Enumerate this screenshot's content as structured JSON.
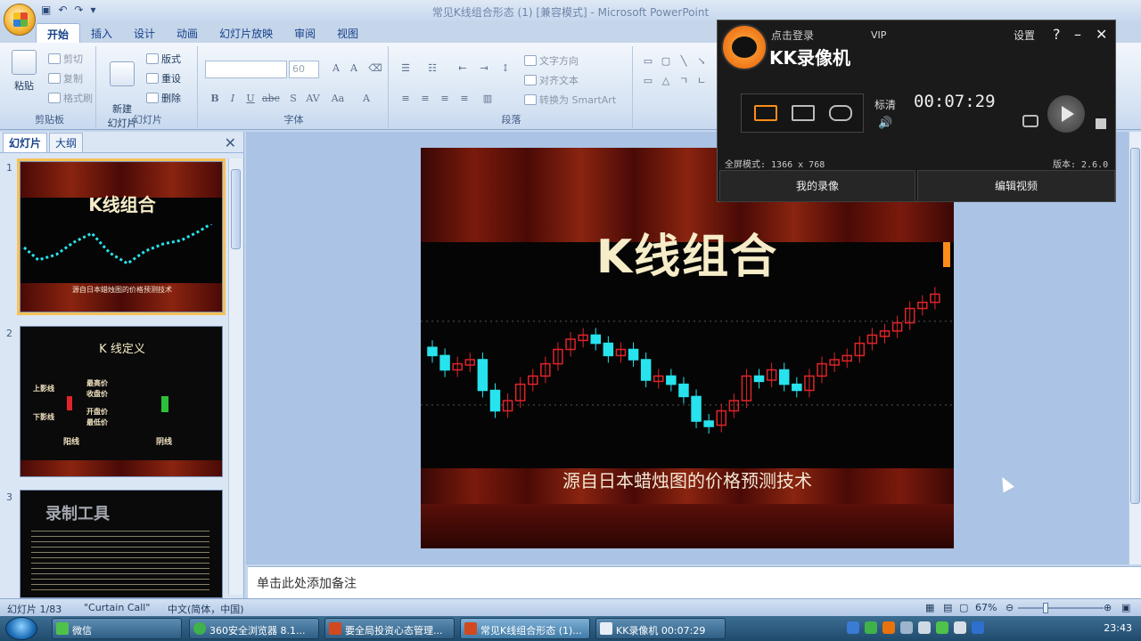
{
  "window": {
    "title": "常见K线组合形态 (1) [兼容模式] - Microsoft PowerPoint"
  },
  "ribbon": {
    "tabs": [
      "开始",
      "插入",
      "设计",
      "动画",
      "幻灯片放映",
      "审阅",
      "视图"
    ],
    "clipboard": {
      "paste": "粘贴",
      "cut": "剪切",
      "copy": "复制",
      "format_painter": "格式刷",
      "label": "剪贴板"
    },
    "slides": {
      "new_slide": "新建\n幻灯片",
      "layout": "版式",
      "reset": "重设",
      "delete": "删除",
      "label": "幻灯片"
    },
    "font": {
      "label": "字体",
      "size_value": "60"
    },
    "paragraph": {
      "text_direction": "文字方向",
      "align_text": "对齐文本",
      "smartart": "转换为 SmartArt",
      "label": "段落"
    }
  },
  "slides_panel": {
    "tabs": [
      "幻灯片",
      "大纲"
    ],
    "thumbs": [
      {
        "num": "1",
        "title": "K线组合",
        "subtitle": "源自日本蜡烛图的价格预测技术"
      },
      {
        "num": "2",
        "title": "K 线定义",
        "labels": [
          "上影线",
          "最高价",
          "收盘价",
          "开盘价",
          "下影线",
          "最低价",
          "阳线",
          "阴线"
        ]
      },
      {
        "num": "3",
        "title": "录制工具"
      }
    ]
  },
  "slide": {
    "title": "K线组合",
    "subtitle": "源自日本蜡烛图的价格预测技术"
  },
  "notes": {
    "placeholder": "单击此处添加备注"
  },
  "status": {
    "slide_info": "幻灯片 1/83",
    "theme": "\"Curtain Call\"",
    "language": "中文(简体，中国)",
    "zoom": "67%"
  },
  "taskbar": {
    "items": [
      "微信",
      "360安全浏览器 8.1...",
      "要全局投资心态管理...",
      "常见K线组合形态 (1)...",
      "KK录像机 00:07:29"
    ],
    "clock": "23:43"
  },
  "recorder": {
    "login": "点击登录",
    "brand": "KK录像机",
    "vip": "VIP",
    "settings": "设置",
    "quality": "标清",
    "time": "00:07:29",
    "fullscreen_mode": "全屏模式: 1366 x 768",
    "version": "版本: 2.6.0",
    "my_recordings": "我的录像",
    "edit_video": "编辑视频",
    "icons": [
      "help-icon",
      "minimize-icon",
      "close-icon",
      "volume-icon",
      "camera-icon",
      "play-icon",
      "stop-icon"
    ]
  },
  "chart_data": {
    "type": "candlestick",
    "title": "",
    "series": [
      {
        "name": "",
        "values": [
          62,
          55,
          58,
          60,
          45,
          35,
          40,
          48,
          52,
          58,
          65,
          70,
          72,
          68,
          62,
          65,
          60,
          50,
          52,
          48,
          42,
          30,
          28,
          35,
          40,
          52,
          50,
          55,
          48,
          45,
          52,
          58,
          60,
          62,
          68,
          72,
          74,
          78,
          85,
          88,
          92
        ]
      }
    ]
  },
  "colors": {
    "up": "#e0242a",
    "down": "#27e3ee",
    "accent": "#ff8c1a"
  }
}
